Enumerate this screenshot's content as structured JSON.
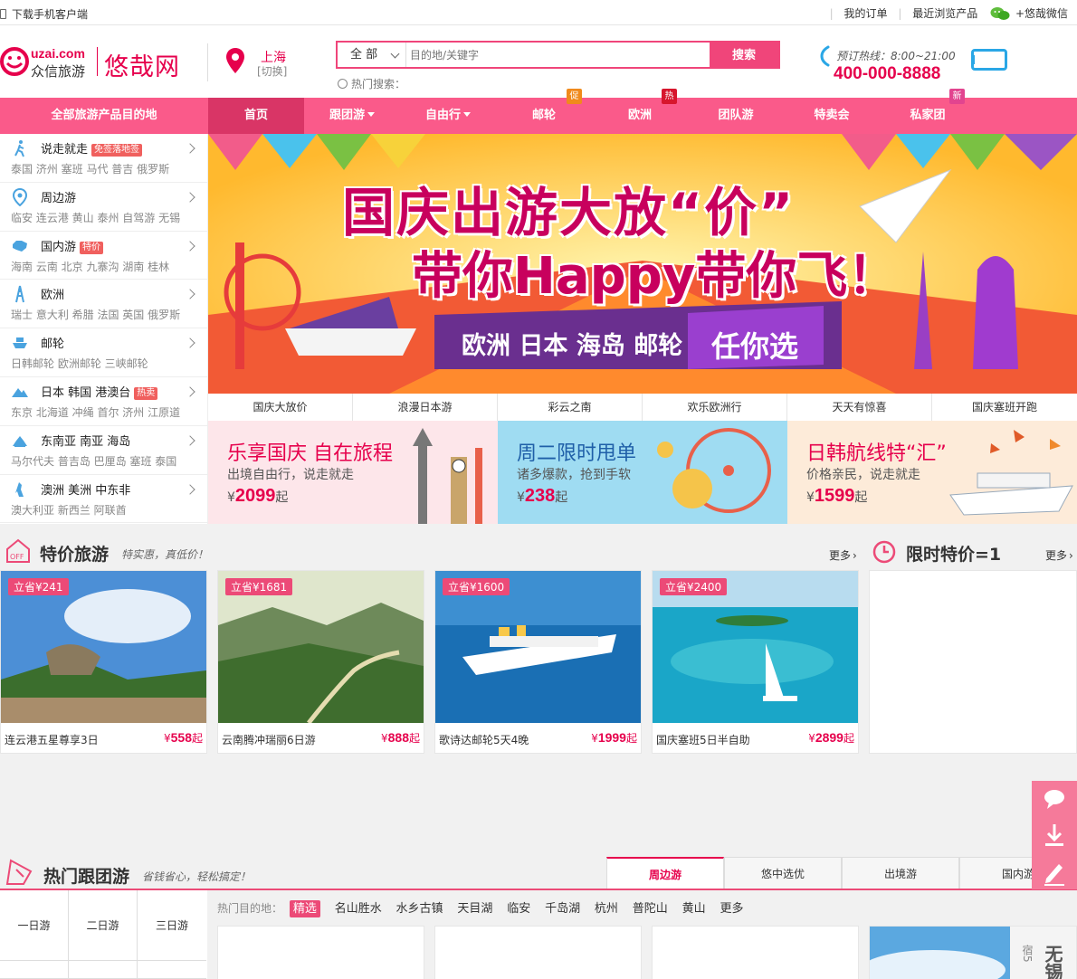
{
  "topbar": {
    "download": "下载手机客户端",
    "my_orders": "我的订单",
    "recent": "最近浏览产品",
    "wechat": "+悠哉微信"
  },
  "header": {
    "logo_en": "uzai.com",
    "logo_cn": "众信旅游",
    "logo_big": "悠哉网",
    "city": "上海",
    "city_switch": "[切换]",
    "search_scope": "全 部",
    "search_placeholder": "目的地/关键字",
    "search_button": "搜索",
    "hot_search": "热门搜索：",
    "hotline_label": "预订热线：8:00~21:00",
    "hotline": "400-000-8888"
  },
  "nav": {
    "all": "全部旅游产品目的地",
    "items": [
      {
        "label": "首页"
      },
      {
        "label": "跟团游"
      },
      {
        "label": "自由行"
      },
      {
        "label": "邮轮",
        "badge": "促"
      },
      {
        "label": "欧洲",
        "badge": "热"
      },
      {
        "label": "团队游"
      },
      {
        "label": "特卖会"
      },
      {
        "label": "私家团",
        "badge": "新"
      }
    ]
  },
  "sidebar": [
    {
      "title": "说走就走",
      "tag": "免签落地签",
      "sub": "泰国  济州  塞班  马代  普吉  俄罗斯",
      "icon": "walker-icon"
    },
    {
      "title": "周边游",
      "tag": "",
      "sub": "临安  连云港  黄山  泰州  自驾游  无锡",
      "icon": "location-icon"
    },
    {
      "title": "国内游",
      "tag": "特价",
      "sub": "海南  云南  北京  九寨沟  湖南  桂林",
      "icon": "china-map-icon"
    },
    {
      "title": "欧洲",
      "tag": "",
      "sub": "瑞士  意大利  希腊  法国  英国  俄罗斯",
      "icon": "eiffel-tower-icon"
    },
    {
      "title": "邮轮",
      "tag": "",
      "sub": "日韩邮轮  欧洲邮轮  三峡邮轮",
      "icon": "cruise-icon"
    },
    {
      "title": "日本  韩国  港澳台",
      "tag": "热卖",
      "sub": "东京  北海道  冲绳  首尔  济州  江原道",
      "icon": "mountain-icon"
    },
    {
      "title": "东南亚  南亚  海岛",
      "tag": "",
      "sub": "马尔代夫  普吉岛  巴厘岛  塞班  泰国",
      "icon": "temple-icon"
    },
    {
      "title": "澳洲  美洲  中东非",
      "tag": "",
      "sub": "澳大利亚  新西兰  阿联酋",
      "icon": "kangaroo-icon"
    }
  ],
  "banner": {
    "line1": "国庆出游大放“价”",
    "line2": "带你Happy带你飞！",
    "sub1": "欧洲 日本 海岛 邮轮",
    "sub2": "任你选"
  },
  "banner_tabs": [
    "国庆大放价",
    "浪漫日本游",
    "彩云之南",
    "欢乐欧洲行",
    "天天有惊喜",
    "国庆塞班开跑"
  ],
  "promos": [
    {
      "title": "乐享国庆 自在旅程",
      "sub": "出境自由行，说走就走",
      "price": "2099",
      "color": "#e6004c",
      "bg": "#fde6ea"
    },
    {
      "title": "周二限时甩单",
      "sub": "诸多爆款，抢到手软",
      "price": "238",
      "color": "#1f5fa8",
      "bg": "#9fdcf2"
    },
    {
      "title": "日韩航线特“汇”",
      "sub": "价格亲民，说走就走",
      "price": "1599",
      "color": "#e6004c",
      "bg": "#fdebd9"
    }
  ],
  "price_unit": "¥",
  "price_suffix": "起",
  "special": {
    "title": "特价旅游",
    "subtitle": "特实惠，真低价！",
    "more": "更多",
    "limit_title": "限时特价=1",
    "limit_more": "更多",
    "cards": [
      {
        "tag": "立省¥241",
        "title": "连云港五星尊享3日",
        "price": "558"
      },
      {
        "tag": "立省¥1681",
        "title": "云南腾冲瑞丽6日游",
        "price": "888"
      },
      {
        "tag": "立省¥1600",
        "title": "歌诗达邮轮5天4晚",
        "price": "1999"
      },
      {
        "tag": "立省¥2400",
        "title": "国庆塞班5日半自助",
        "price": "2899"
      }
    ]
  },
  "hot_group": {
    "title": "热门跟团游",
    "subtitle": "省钱省心，轻松搞定！",
    "tabs": [
      "周边游",
      "悠中选优",
      "出境游",
      "国内游"
    ],
    "days": [
      "一日游",
      "二日游",
      "三日游"
    ],
    "dest_label": "热门目的地：",
    "dests": [
      "精选",
      "名山胜水",
      "水乡古镇",
      "天目湖",
      "临安",
      "千岛湖",
      "杭州",
      "普陀山",
      "黄山",
      "更多"
    ],
    "side_text": "无锡",
    "side_small": "宿5"
  }
}
